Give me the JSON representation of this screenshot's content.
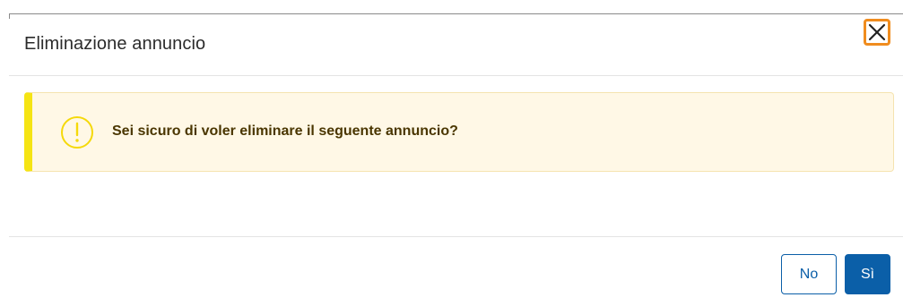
{
  "modal": {
    "title": "Eliminazione annuncio",
    "close_icon": "close-icon"
  },
  "alert": {
    "icon": "warning-circle-icon",
    "message": "Sei sicuro di voler eliminare il seguente annuncio?",
    "accent_color": "#f5e414",
    "background_color": "#fff8e6"
  },
  "footer": {
    "no_label": "No",
    "si_label": "Sì",
    "primary_color": "#0b5fa8"
  },
  "focus_ring_color": "#f08c1e"
}
